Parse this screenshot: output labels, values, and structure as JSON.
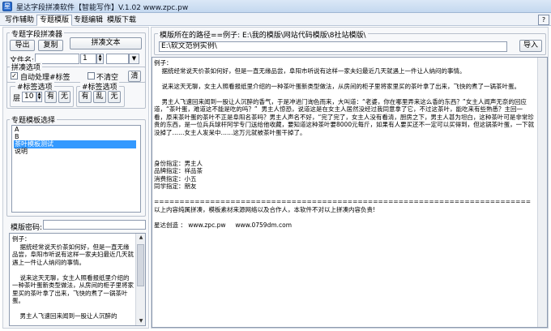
{
  "window": {
    "title": "星达字段拼凑软件【智能写作】V.1.02    www.zpc.pw",
    "help_label": "?"
  },
  "tabs": [
    {
      "label": "写作辅助"
    },
    {
      "label": "专题模版"
    },
    {
      "label": "专题编辑"
    },
    {
      "label": "模版下载"
    }
  ],
  "left": {
    "collector_legend": "专题字段拼凑器",
    "export_label": "导出",
    "copy_label": "复制",
    "compose_label": "拼凑文本",
    "filename_label": "文件名:",
    "filename_value": "",
    "count_value": "1",
    "options_legend": "拼凑选项",
    "auto_tag_label": "自动处理#标签",
    "auto_tag_checked": "✓",
    "no_clear_label": "不清空",
    "clear_label": "清",
    "tag_legend_1": "#标签选项",
    "layer_label": "层",
    "layer_value": "10",
    "have_label": "有",
    "none_label": "无",
    "tag_legend_2": "#标签选项",
    "have_label2": "有",
    "random_label": "乱",
    "none_label2": "无",
    "templates_legend": "专题模板选择",
    "templates": [
      "A",
      "B",
      "茶叶模板测试",
      "说明"
    ],
    "selected_template_index": 2,
    "password_label": "模版密码:",
    "password_value": "",
    "preview_text": "例子：\n    据统经常说天价茶如何好，但是一直无缘品尝，阜阳市听说有这样一家夫妇最近几天就遇上一件让人纳闷的事情。\n\n    说来这天无聊，女主人照看报纸里介绍的一种茶叶蛋新类型做法，从房间的柜子里将家里买的茶叶拿了出来，飞快的煮了一锅茶叶蛋。\n\n    男主人飞速回来闻到一股让人沉醉的"
  },
  "right": {
    "path_legend": "模版所在的路径==例子: E:\\我的模版\\网站代码模版\\8社站模版\\",
    "path_label": "E:",
    "path_value": "E:\\软文范例实例\\",
    "import_label": "导入",
    "content_lines": [
      "例子：",
      "    据统经常说天价茶如何好，但是一直无缘品尝，阜阳市听说有这样一家夫妇最近几天就遇上一件让人纳闷的事情。",
      "",
      "    说来这天无聊，女主人照看报纸里介绍的一种茶叶蛋新类型做法，从房间的柜子里将家里买的茶叶拿了出来，飞快的煮了一锅茶叶蛋。",
      "",
      "    男主人飞速回来闻到一股让人沉醉的香气，于是冲进门询色而来，大叫道：“老婆，你在哪里弄来这么香的东西？”女主人闻声无奈的回应道，“茶叶蛋，难道这不能是吃的吗？”  男主人惊恐，说道这是在女主人居然没经过我同意拿了它，不过这茶叶，能吃来有些熟悉？主回一看，原来茶叶蛋的茶叶不正是阜阳名茶吗？男主人声名不好，“完了完了，女主人没有看清，厨房之下，男主人甚为坦白，这种茶叶可是非常珍贵的东西，是一位兵兵球杆阿学专门送给他收藏，要知道这种茶叶要8000元每斤，如果有人要买还不一定可以买得到，但这锅茶叶蛋，一下就没掉了……女主人发呆中……这万元就被茶叶蛋干掉了。",
      "",
      "",
      "",
      "身份指定：男主人",
      "品牌指定：祥品茶",
      "消费指定：小五",
      "同学指定：朋友",
      "",
      "==========================================================================",
      "以上内容纯属拼凑，模板素材来源网络以及合作人，本软件不对以上拼凑内容负责!",
      "",
      "星达创造 ： www.zpc.pw     www.0759dm.com"
    ]
  }
}
